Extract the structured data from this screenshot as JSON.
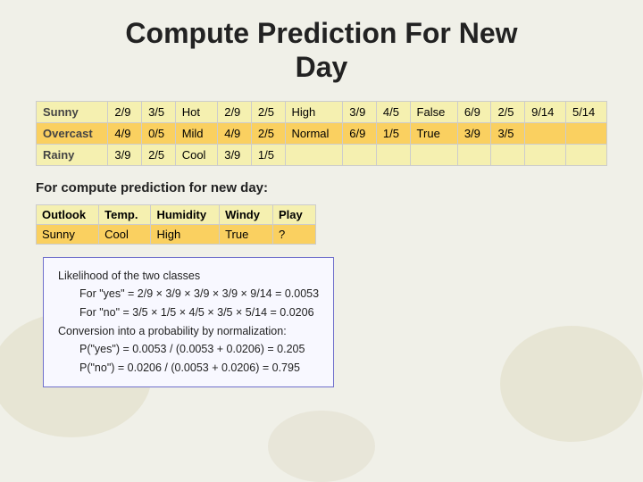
{
  "title": {
    "line1": "Compute Prediction For New",
    "line2": "Day"
  },
  "main_table": {
    "rows": [
      {
        "label": "Sunny",
        "cols": [
          "2/9",
          "3/5",
          "Hot",
          "2/9",
          "2/5",
          "High",
          "3/9",
          "4/5",
          "False",
          "6/9",
          "2/5",
          "9/14",
          "5/14"
        ]
      },
      {
        "label": "Overcast",
        "cols": [
          "4/9",
          "0/5",
          "Mild",
          "4/9",
          "2/5",
          "Normal",
          "6/9",
          "1/5",
          "True",
          "3/9",
          "3/5",
          "",
          ""
        ]
      },
      {
        "label": "Rainy",
        "cols": [
          "3/9",
          "2/5",
          "Cool",
          "3/9",
          "1/5",
          "",
          "",
          "",
          "",
          "",
          "",
          "",
          ""
        ]
      }
    ]
  },
  "prediction_section": {
    "label": "For compute prediction for new day:",
    "table_headers": [
      "Outlook",
      "Temp.",
      "Humidity",
      "Windy",
      "Play"
    ],
    "table_row": [
      "Sunny",
      "Cool",
      "High",
      "True",
      "?"
    ],
    "calc_lines": [
      "Likelihood of the two classes",
      "For \"yes\" = 2/9 × 3/9 × 3/9 ×  3/9 × 9/14 = 0.0053",
      "For \"no\" = 3/5 × 1/5 × 4/5 × 3/5 × 5/14 = 0.0206",
      "Conversion into a probability by normalization:",
      "P(\"yes\") = 0.0053 / (0.0053 + 0.0206) = 0.205",
      "P(\"no\") = 0.0206 / (0.0053 + 0.0206) = 0.795"
    ]
  }
}
